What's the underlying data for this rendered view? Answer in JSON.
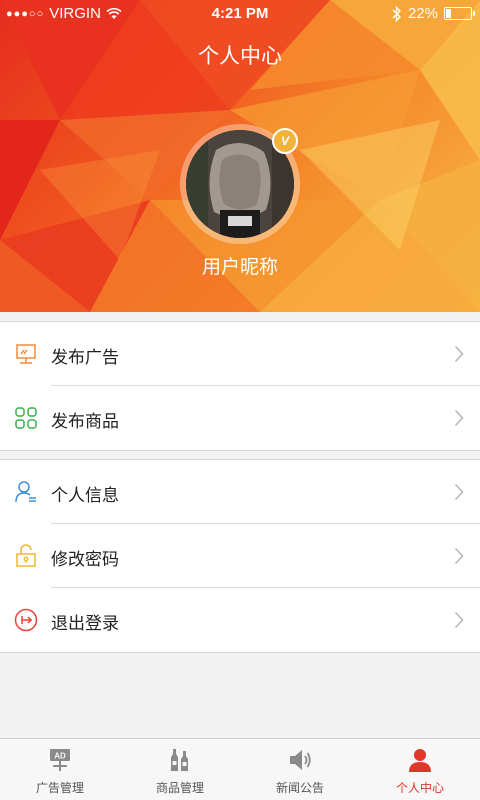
{
  "status_bar": {
    "carrier": "VIRGIN",
    "time": "4:21 PM",
    "battery": "22%",
    "battery_level": 0.22
  },
  "header": {
    "title": "个人中心",
    "nickname": "用户昵称",
    "badge_icon": "vip-badge-icon",
    "badge_text": "V"
  },
  "menu_group_1": {
    "items": [
      {
        "label": "发布广告",
        "icon": "ad-board-icon"
      },
      {
        "label": "发布商品",
        "icon": "grid-apps-icon"
      }
    ]
  },
  "menu_group_2": {
    "items": [
      {
        "label": "个人信息",
        "icon": "user-info-icon"
      },
      {
        "label": "修改密码",
        "icon": "lock-icon"
      },
      {
        "label": "退出登录",
        "icon": "logout-icon"
      }
    ]
  },
  "tabbar": {
    "tabs": [
      {
        "label": "广告管理",
        "icon": "ad-icon"
      },
      {
        "label": "商品管理",
        "icon": "bottles-icon"
      },
      {
        "label": "新闻公告",
        "icon": "speaker-icon"
      },
      {
        "label": "个人中心",
        "icon": "person-icon",
        "active": true
      }
    ]
  },
  "colors": {
    "accent": "#e0372a",
    "header_red": "#e52c1e",
    "header_orange": "#f58a2a",
    "icon_orange": "#f08a3c",
    "icon_green": "#3bb24a",
    "icon_blue": "#3d8fd6",
    "icon_yellow": "#f2b632",
    "icon_red": "#e8423a"
  }
}
